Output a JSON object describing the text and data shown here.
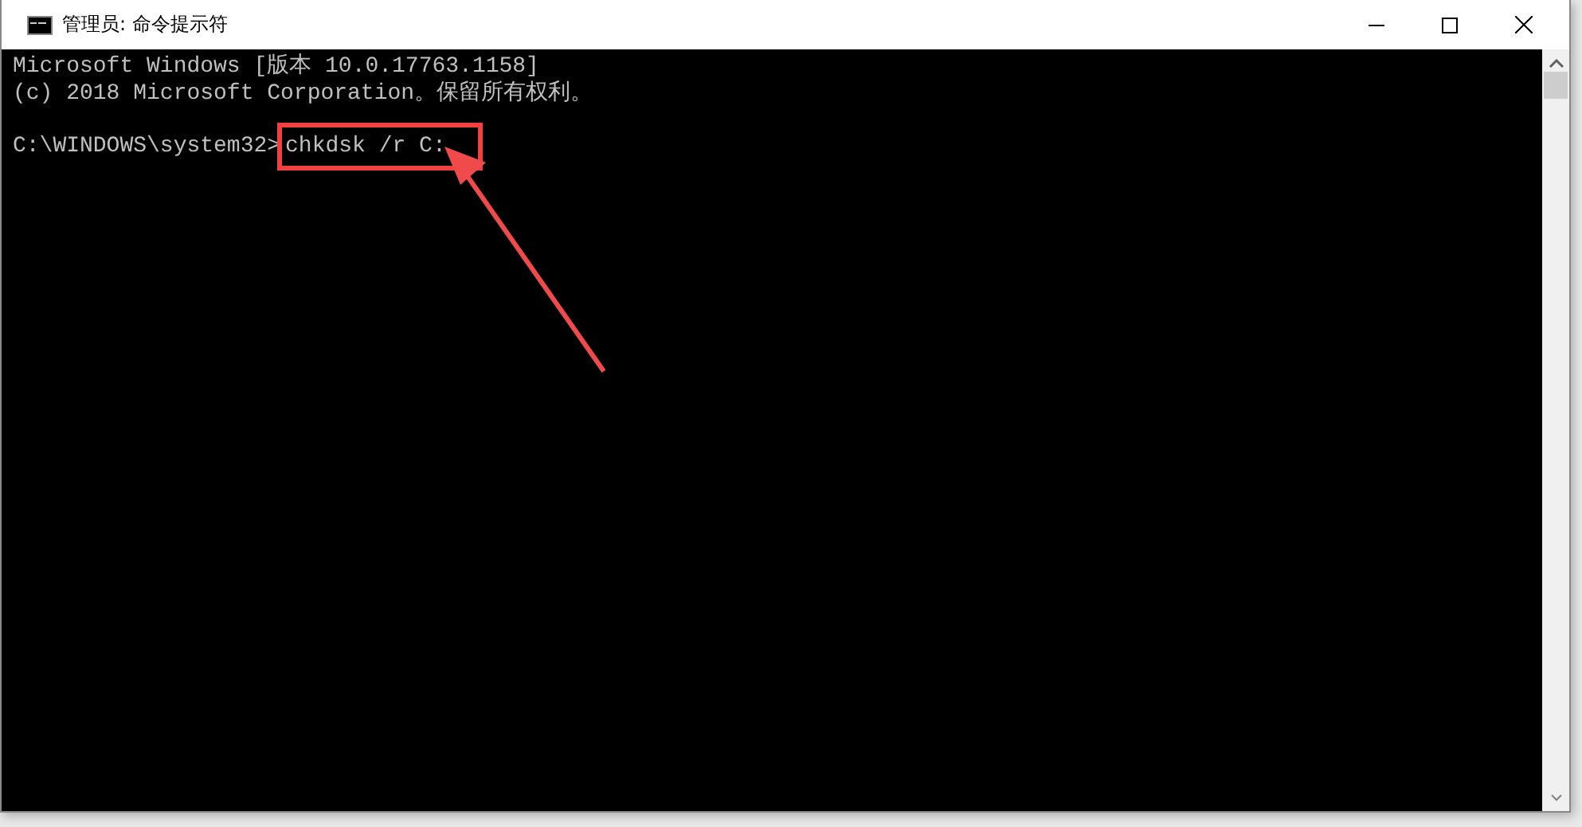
{
  "window": {
    "title": "管理员: 命令提示符"
  },
  "console": {
    "lines": [
      "Microsoft Windows [版本 10.0.17763.1158]",
      "(c) 2018 Microsoft Corporation。保留所有权利。"
    ],
    "prompt": "C:\\WINDOWS\\system32>",
    "command": "chkdsk /r C:"
  }
}
